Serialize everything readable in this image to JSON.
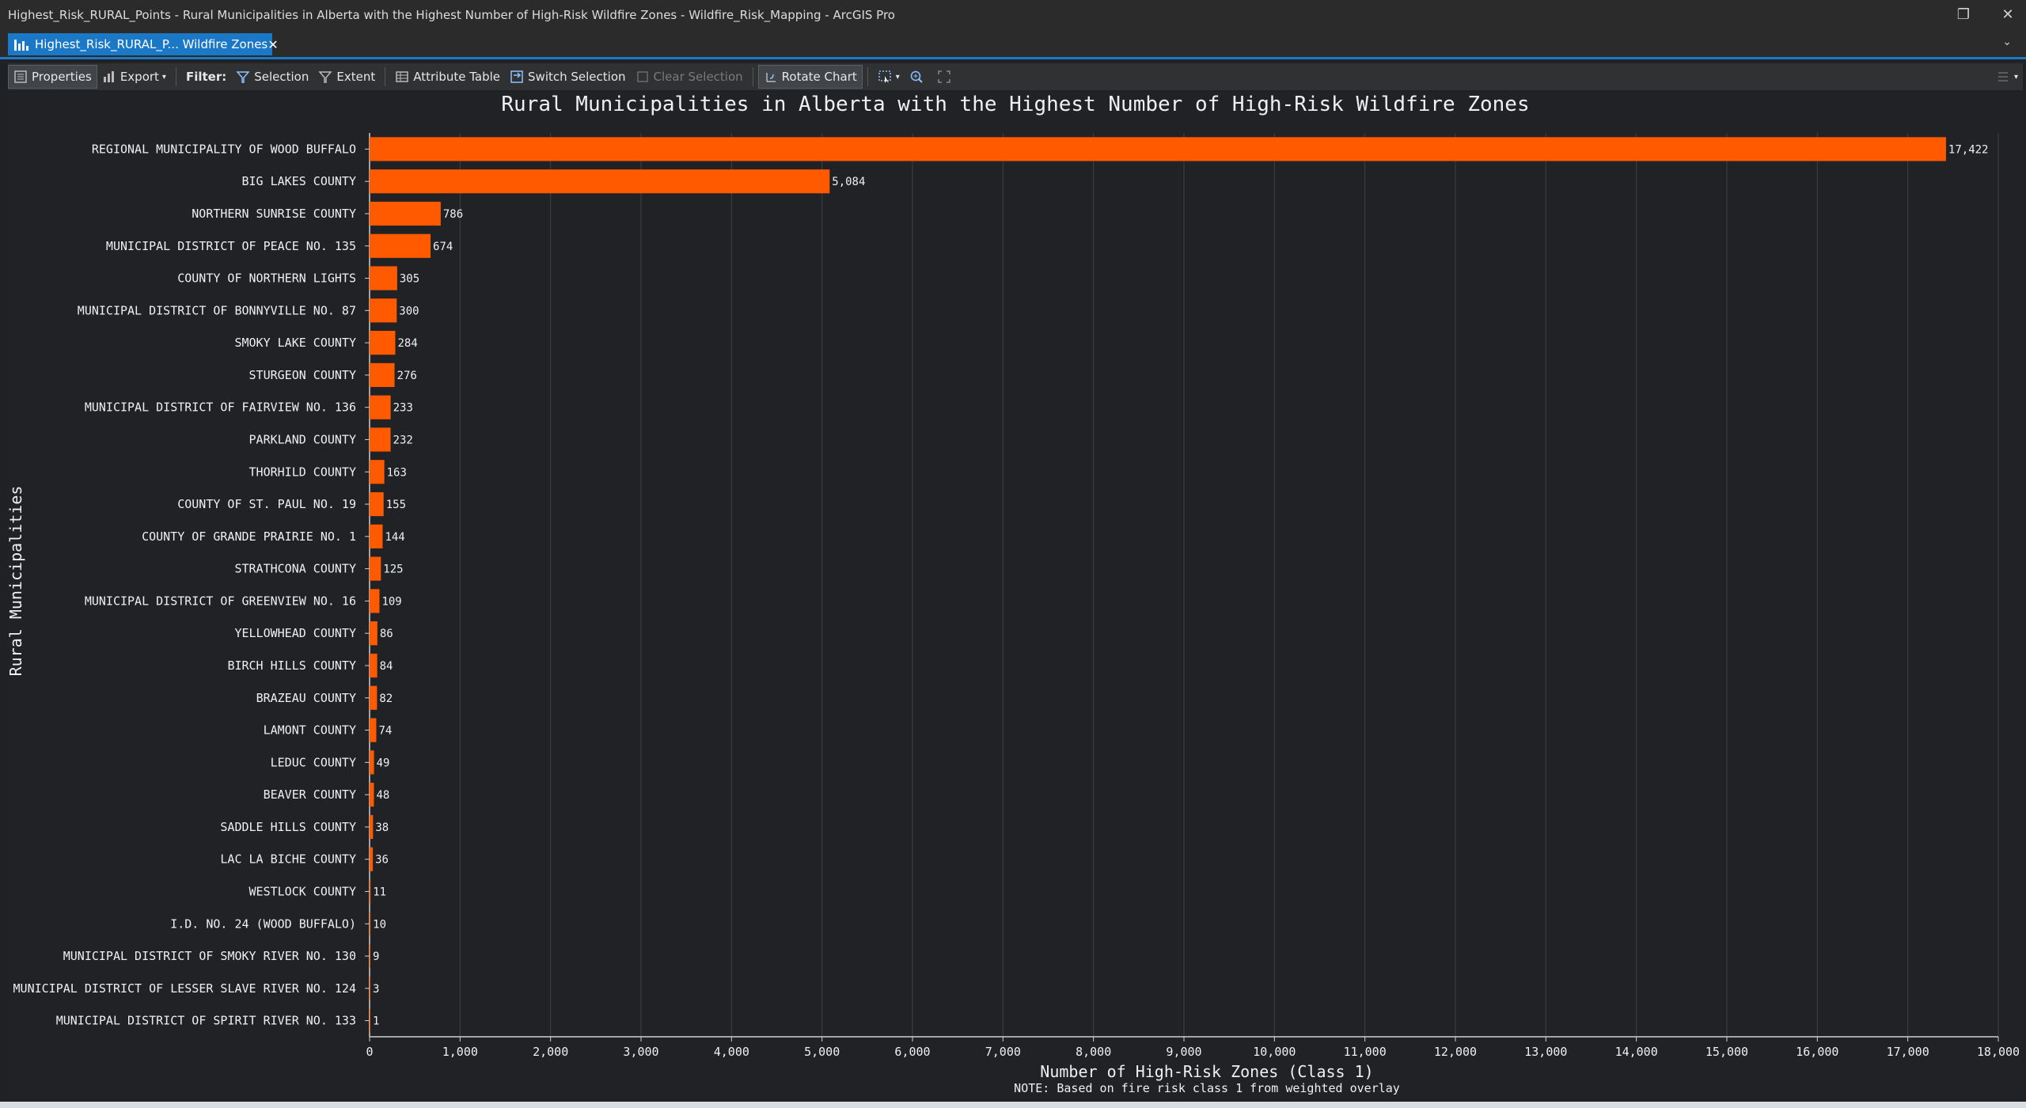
{
  "window": {
    "title": "Highest_Risk_RURAL_Points - Rural Municipalities in Alberta with the Highest Number of High-Risk Wildfire Zones - Wildfire_Risk_Mapping - ArcGIS Pro",
    "restore_glyph": "❐",
    "close_glyph": "✕"
  },
  "tab": {
    "label": "Highest_Risk_RURAL_P... Wildfire Zones",
    "close": "✕",
    "overflow": "⌄"
  },
  "toolbar": {
    "properties": "Properties",
    "export": "Export",
    "filter_label": "Filter:",
    "selection": "Selection",
    "extent": "Extent",
    "attribute_table": "Attribute Table",
    "switch_selection": "Switch Selection",
    "clear_selection": "Clear Selection",
    "rotate_chart": "Rotate Chart"
  },
  "colors": {
    "bar": "#ff5a00",
    "accent": "#1b78c7",
    "grid": "#3e4145"
  },
  "chart_data": {
    "type": "bar",
    "orientation": "horizontal",
    "title": "Rural Municipalities in Alberta with the Highest Number of High-Risk Wildfire Zones",
    "xlabel": "Number of High-Risk Zones (Class 1)",
    "ylabel": "Rural Municipalities",
    "note": "NOTE: Based on fire risk class 1 from weighted overlay",
    "xlim": [
      0,
      18000
    ],
    "xticks": [
      "0",
      "1,000",
      "2,000",
      "3,000",
      "4,000",
      "5,000",
      "6,000",
      "7,000",
      "8,000",
      "9,000",
      "10,000",
      "11,000",
      "12,000",
      "13,000",
      "14,000",
      "15,000",
      "16,000",
      "17,000",
      "18,000"
    ],
    "grid": true,
    "categories": [
      "REGIONAL MUNICIPALITY OF WOOD BUFFALO",
      "BIG LAKES COUNTY",
      "NORTHERN SUNRISE COUNTY",
      "MUNICIPAL DISTRICT OF PEACE NO. 135",
      "COUNTY OF NORTHERN LIGHTS",
      "MUNICIPAL DISTRICT OF BONNYVILLE NO. 87",
      "SMOKY LAKE COUNTY",
      "STURGEON COUNTY",
      "MUNICIPAL DISTRICT OF FAIRVIEW NO. 136",
      "PARKLAND COUNTY",
      "THORHILD COUNTY",
      "COUNTY OF ST. PAUL NO. 19",
      "COUNTY OF GRANDE PRAIRIE NO. 1",
      "STRATHCONA COUNTY",
      "MUNICIPAL DISTRICT OF GREENVIEW NO. 16",
      "YELLOWHEAD COUNTY",
      "BIRCH HILLS COUNTY",
      "BRAZEAU COUNTY",
      "LAMONT COUNTY",
      "LEDUC COUNTY",
      "BEAVER COUNTY",
      "SADDLE HILLS COUNTY",
      "LAC LA BICHE COUNTY",
      "WESTLOCK COUNTY",
      "I.D. NO. 24 (WOOD BUFFALO)",
      "MUNICIPAL DISTRICT OF SMOKY RIVER NO. 130",
      "MUNICIPAL DISTRICT OF LESSER SLAVE RIVER NO. 124",
      "MUNICIPAL DISTRICT OF SPIRIT RIVER NO. 133"
    ],
    "values": [
      17422,
      5084,
      786,
      674,
      305,
      300,
      284,
      276,
      233,
      232,
      163,
      155,
      144,
      125,
      109,
      86,
      84,
      82,
      74,
      49,
      48,
      38,
      36,
      11,
      10,
      9,
      3,
      1
    ],
    "value_labels": [
      "17,422",
      "5,084",
      "786",
      "674",
      "305",
      "300",
      "284",
      "276",
      "233",
      "232",
      "163",
      "155",
      "144",
      "125",
      "109",
      "86",
      "84",
      "82",
      "74",
      "49",
      "48",
      "38",
      "36",
      "11",
      "10",
      "9",
      "3",
      "1"
    ]
  }
}
